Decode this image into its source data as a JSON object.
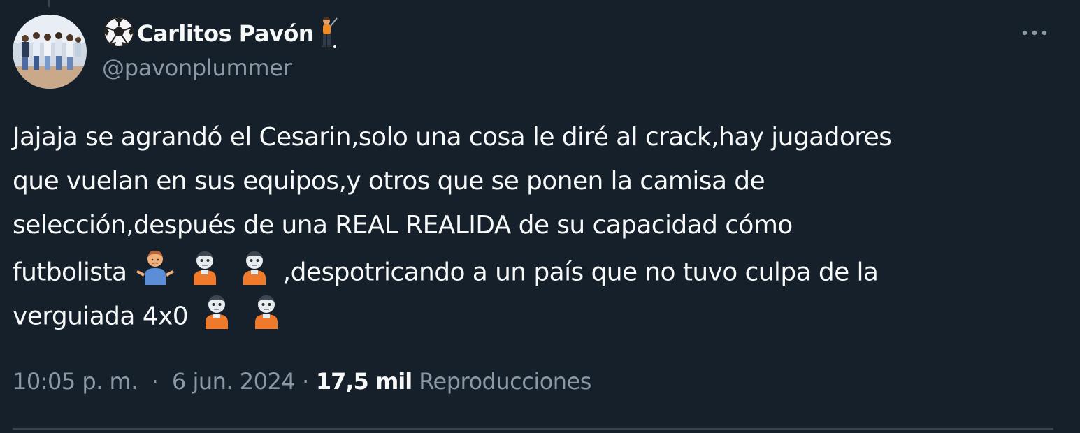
{
  "author": {
    "display_name": "Carlitos Pavón",
    "handle": "@pavonplummer",
    "name_prefix_icon": "soccer-ball-icon",
    "name_suffix_icon": "person-golfing-icon"
  },
  "more_icon": "more-horizontal-icon",
  "body": {
    "line1": "Jajaja se agrandó el Cesarin,solo una cosa le diré al crack,hay jugadores",
    "line2": "que vuelan en sus equipos,y otros que  se ponen la camisa de",
    "line3": "selección,después de una REAL REALIDA de su capacidad  cómo",
    "line4_a": "futbolista",
    "line4_b": ",despotricando a un país que no tuvo culpa de la",
    "line5": "verguiada 4x0",
    "emojis_line4": [
      "person-shrugging-icon",
      "zombie-icon",
      "zombie-icon"
    ],
    "emojis_line5": [
      "zombie-icon",
      "zombie-icon"
    ]
  },
  "meta": {
    "time": "10:05 p. m.",
    "separator": "·",
    "date": "6 jun. 2024",
    "views_count": "17,5 mil",
    "views_label": "Reproducciones"
  },
  "colors": {
    "background": "#15202b",
    "text": "#f7f9f9",
    "secondary": "#8b98a5",
    "divider": "#38444d"
  }
}
